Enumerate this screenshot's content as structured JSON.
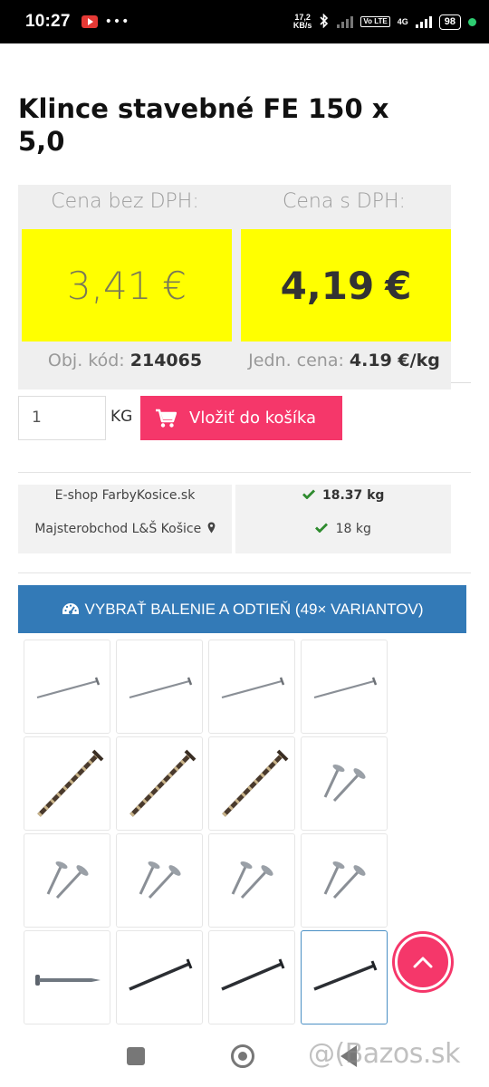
{
  "status_bar": {
    "time": "10:27",
    "dots": "•••",
    "speed_value": "17,2",
    "speed_unit": "KB/s",
    "volte": "Vo LTE",
    "network": "4G",
    "battery": "98"
  },
  "product": {
    "title": "Klince stavebné FE 150 x 5,0"
  },
  "price": {
    "net_label": "Cena bez DPH:",
    "net_value": "3,41",
    "gross_label": "Cena s DPH:",
    "gross_value": "4,19",
    "currency": "€",
    "code_label": "Obj. kód:",
    "code_value": "214065",
    "unit_price_label": "Jedn. cena:",
    "unit_price_value": "4.19 €/kg"
  },
  "cart": {
    "quantity": "1",
    "unit": "KG",
    "button_label": "Vložiť do košíka"
  },
  "stock": [
    {
      "store": "E-shop FarbyKosice.sk",
      "qty": "18.37 kg"
    },
    {
      "store": "Majsterobchod L&Š Košice",
      "qty": "18 kg"
    }
  ],
  "variants": {
    "label": "VYBRAŤ BALENIE A ODTIEŇ (49× VARIANTOV)"
  },
  "watermark": "@(Bazos.sk",
  "icons": {
    "cart": "cart-icon",
    "map_marker": "map-marker-icon",
    "check": "check-icon",
    "dashboard": "dashboard-icon",
    "scroll_up": "chevron-up-icon"
  },
  "colors": {
    "price_highlight": "#ffff00",
    "cart_button": "#f5376a",
    "variant_button": "#337ab7",
    "stock_check": "#2e8b2e"
  }
}
